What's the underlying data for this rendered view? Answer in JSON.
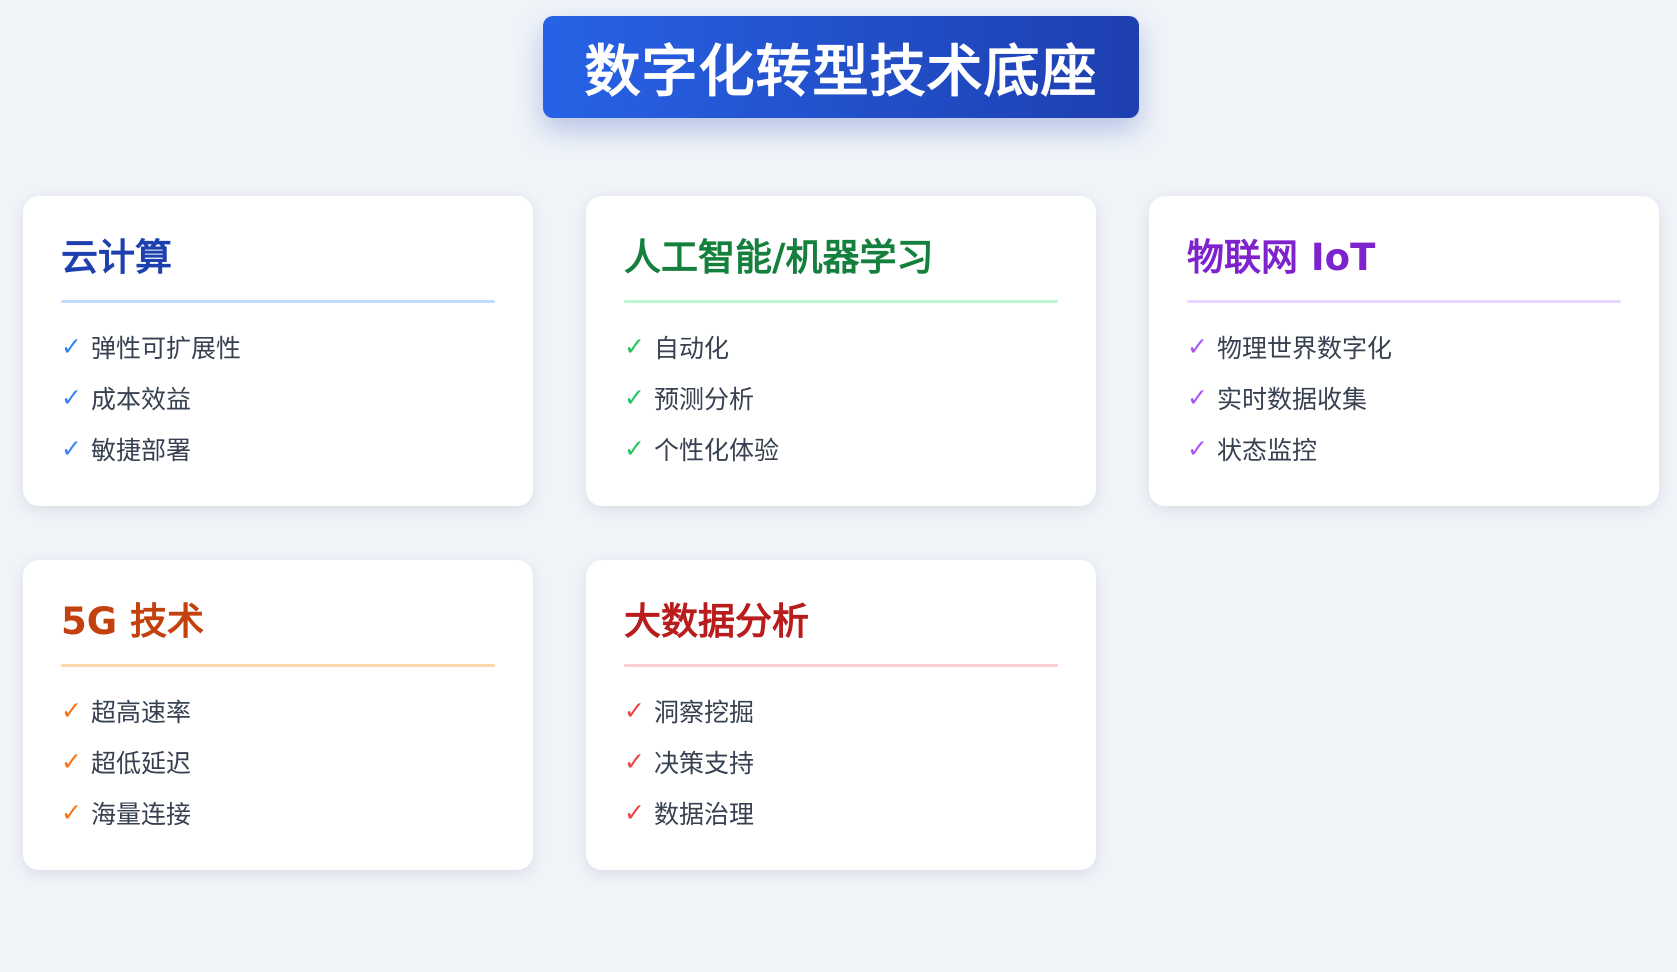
{
  "title": "数字化转型技术底座",
  "cards": [
    {
      "title": "云计算",
      "color": "#1e40af",
      "divider_color": "#bfdbfe",
      "check_color": "#3b82f6",
      "items": [
        "弹性可扩展性",
        "成本效益",
        "敏捷部署"
      ]
    },
    {
      "title": "人工智能/机器学习",
      "color": "#15803d",
      "divider_color": "#bbf7d0",
      "check_color": "#22c55e",
      "items": [
        "自动化",
        "预测分析",
        "个性化体验"
      ]
    },
    {
      "title": "物联网 IoT",
      "color": "#7e22ce",
      "divider_color": "#e9d5ff",
      "check_color": "#a855f7",
      "items": [
        "物理世界数字化",
        "实时数据收集",
        "状态监控"
      ]
    },
    {
      "title": "5G 技术",
      "color": "#c2410c",
      "divider_color": "#fed7aa",
      "check_color": "#f97316",
      "items": [
        "超高速率",
        "超低延迟",
        "海量连接"
      ]
    },
    {
      "title": "大数据分析",
      "color": "#b91c1c",
      "divider_color": "#fecdd3",
      "check_color": "#ef4444",
      "items": [
        "洞察挖掘",
        "决策支持",
        "数据治理"
      ]
    }
  ],
  "check_icon": "check-mark-icon"
}
